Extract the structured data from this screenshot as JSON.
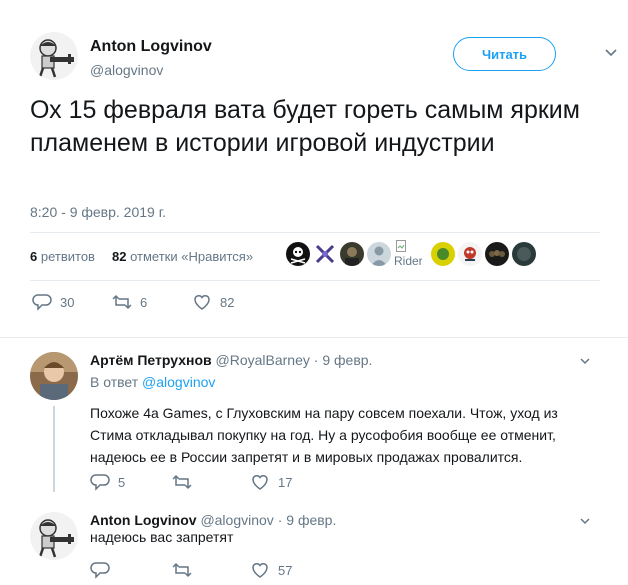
{
  "tweet": {
    "author_name": "Anton Logvinov",
    "author_handle": "@alogvinov",
    "follow_label": "Читать",
    "text": "Ох 15 февраля вата будет гореть самым ярким пламенем в истории игровой индустрии",
    "timestamp": "8:20 - 9 февр. 2019 г.",
    "retweets_count": "6",
    "retweets_label": "ретвитов",
    "likes_count": "82",
    "likes_label": "отметки «Нравится»",
    "liker_avatars": [
      "pirate-skull",
      "crossed-swords",
      "dark-photo",
      "default-avatar",
      "rider-broken-image",
      "yellow-green",
      "colorful-art",
      "dark-figures",
      "dark-circle"
    ],
    "liker_broken_alt": "Rider",
    "actions": {
      "replies": "30",
      "retweets": "6",
      "likes": "82"
    }
  },
  "replies": [
    {
      "author_name": "Артём Петрухнов",
      "author_handle": "@RoyalBarney",
      "dot": "·",
      "time": "9 февр.",
      "in_reply_prefix": "В ответ",
      "in_reply_handle": "@alogvinov",
      "text_lines": [
        "Похоже 4а Games, с Глуховским на пару совсем поехали. Чтож, уход из",
        "Стима откладывал покупку на год. Ну а русофобия вообще ее отменит,",
        "надеюсь ее в России запретят и в мировых продажах провалится."
      ],
      "actions": {
        "replies": "5",
        "retweets": "",
        "likes": "17"
      }
    },
    {
      "author_name": "Anton Logvinov",
      "author_handle": "@alogvinov",
      "dot": "·",
      "time": "9 февр.",
      "text_lines": [
        "надеюсь вас запретят"
      ],
      "actions": {
        "replies": "",
        "retweets": "",
        "likes": "57"
      }
    }
  ],
  "colors": {
    "accent": "#1da1f2",
    "secondary_text": "#657786",
    "divider": "#e6ecf0",
    "thread_line": "#ccd6dd"
  }
}
